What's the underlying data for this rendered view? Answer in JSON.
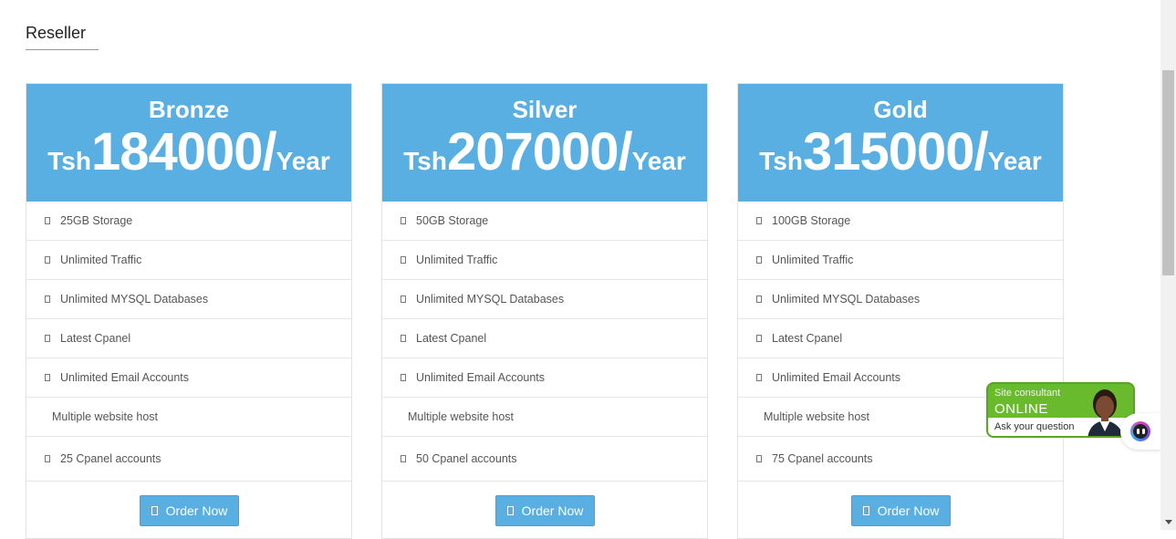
{
  "section": {
    "title": "Reseller"
  },
  "plans": [
    {
      "name": "Bronze",
      "currency": "Tsh",
      "amount": "184000/",
      "period": "Year",
      "features": [
        "25GB Storage",
        "Unlimited Traffic",
        "Unlimited MYSQL Databases",
        "Latest Cpanel",
        "Unlimited Email Accounts",
        "Multiple website host",
        "25 Cpanel accounts"
      ],
      "button": "Order Now"
    },
    {
      "name": "Silver",
      "currency": "Tsh",
      "amount": "207000/",
      "period": "Year",
      "features": [
        "50GB Storage",
        "Unlimited Traffic",
        "Unlimited MYSQL Databases",
        "Latest Cpanel",
        "Unlimited Email Accounts",
        "Multiple website host",
        "50 Cpanel accounts"
      ],
      "button": "Order Now"
    },
    {
      "name": "Gold",
      "currency": "Tsh",
      "amount": "315000/",
      "period": "Year",
      "features": [
        "100GB Storage",
        "Unlimited Traffic",
        "Unlimited MYSQL Databases",
        "Latest Cpanel",
        "Unlimited Email Accounts",
        "Multiple website host",
        "75 Cpanel accounts"
      ],
      "button": "Order Now"
    }
  ],
  "consultant": {
    "line1": "Site consultant",
    "status": "ONLINE",
    "cta": "Ask your question"
  },
  "colors": {
    "accent": "#5aafe2",
    "consultant_green": "#6aba2e"
  }
}
